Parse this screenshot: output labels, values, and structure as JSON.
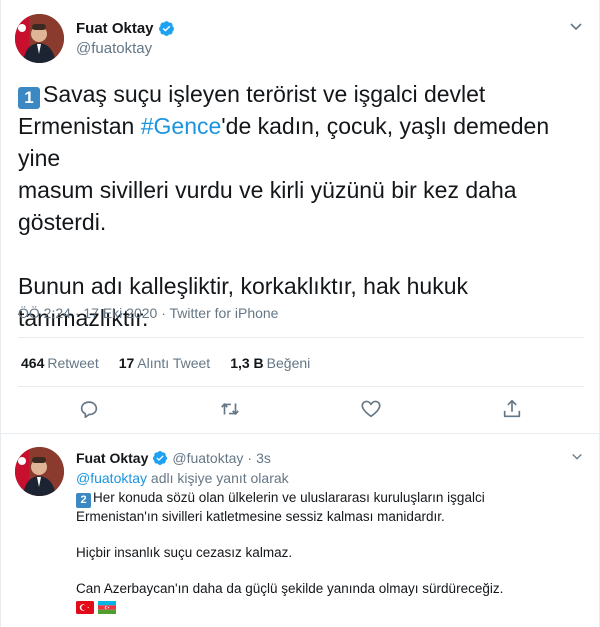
{
  "main_tweet": {
    "author_name": "Fuat Oktay",
    "author_handle": "@fuatoktay",
    "number_badge": "1",
    "line1": "Savaş suçu işleyen terörist ve işgalci devlet",
    "line2_prefix": "Ermenistan ",
    "hashtag": "#Gence",
    "line2_suffix": "'de kadın, çocuk, yaşlı demeden yine",
    "line3": "masum sivilleri vurdu ve kirli yüzünü bir kez daha",
    "line4": "gösterdi.",
    "line5": "Bunun adı kalleşliktir, korkaklıktır, hak hukuk",
    "line6": "tanımazlıktır.",
    "time": "ÖÖ 2:24",
    "separator": "·",
    "date": "17 Eki 2020",
    "source": "Twitter for iPhone",
    "stats": {
      "retweets_count": "464",
      "retweets_label": "Retweet",
      "quotes_count": "17",
      "quotes_label": "Alıntı Tweet",
      "likes_count": "1,3 B",
      "likes_label": "Beğeni"
    }
  },
  "reply_tweet": {
    "author_name": "Fuat Oktay",
    "author_handle": "@fuatoktay",
    "separator": "·",
    "time_ago": "3s",
    "replying_mention": "@fuatoktay",
    "replying_suffix": " adlı kişiye yanıt olarak",
    "number_badge": "2",
    "para1_line1": "Her konuda sözü olan ülkelerin ve uluslararası kuruluşların işgalci",
    "para1_line2": "Ermenistan'ın sivilleri katletmesine sessiz kalması manidardır.",
    "para2": "Hiçbir insanlık suçu cezasız kalmaz.",
    "para3": "Can Azerbaycan'ın daha da güçlü şekilde yanında olmayı sürdüreceğiz.",
    "flags": [
      "turkey-flag",
      "azerbaijan-flag"
    ]
  },
  "colors": {
    "link": "#1b95e0",
    "secondary_text": "#657786",
    "verified": "#1da1f2",
    "badge": "#3b88c3"
  },
  "icons": [
    "verified-badge-icon",
    "chevron-down-icon",
    "reply-icon",
    "retweet-icon",
    "like-icon",
    "share-icon"
  ]
}
